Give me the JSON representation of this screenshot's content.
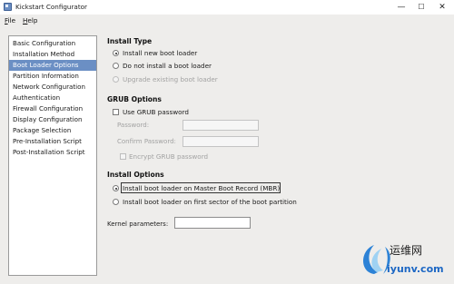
{
  "window": {
    "title": "Kickstart Configurator"
  },
  "window_controls": {
    "minimize": "—",
    "maximize": "☐",
    "close": "✕"
  },
  "menu": {
    "file": "File",
    "help": "Help"
  },
  "sidebar": {
    "items": [
      {
        "label": "Basic Configuration"
      },
      {
        "label": "Installation Method"
      },
      {
        "label": "Boot Loader Options"
      },
      {
        "label": "Partition Information"
      },
      {
        "label": "Network Configuration"
      },
      {
        "label": "Authentication"
      },
      {
        "label": "Firewall Configuration"
      },
      {
        "label": "Display Configuration"
      },
      {
        "label": "Package Selection"
      },
      {
        "label": "Pre-Installation Script"
      },
      {
        "label": "Post-Installation Script"
      }
    ],
    "selected": "Boot Loader Options"
  },
  "install_type": {
    "title": "Install Type",
    "options": [
      {
        "label": "Install new boot loader",
        "checked": true,
        "enabled": true
      },
      {
        "label": "Do not install a boot loader",
        "checked": false,
        "enabled": true
      },
      {
        "label": "Upgrade existing boot loader",
        "checked": false,
        "enabled": false
      }
    ]
  },
  "grub_options": {
    "title": "GRUB Options",
    "use_grub_password": "Use GRUB password",
    "password_label": "Password:",
    "password_value": "",
    "confirm_label": "Confirm Password:",
    "confirm_value": "",
    "encrypt_label": "Encrypt GRUB password"
  },
  "install_options": {
    "title": "Install Options",
    "options": [
      {
        "label": "Install boot loader on Master Boot Record (MBR)",
        "checked": true
      },
      {
        "label": "Install boot loader on first sector of the boot partition",
        "checked": false
      }
    ]
  },
  "kernel": {
    "label": "Kernel parameters:",
    "value": ""
  },
  "watermark": {
    "name": "运维网",
    "url": "iyunv.com"
  },
  "colors": {
    "selection": "#6b8fc4",
    "background": "#eeedeb",
    "watermark_url": "#1c67c4"
  }
}
